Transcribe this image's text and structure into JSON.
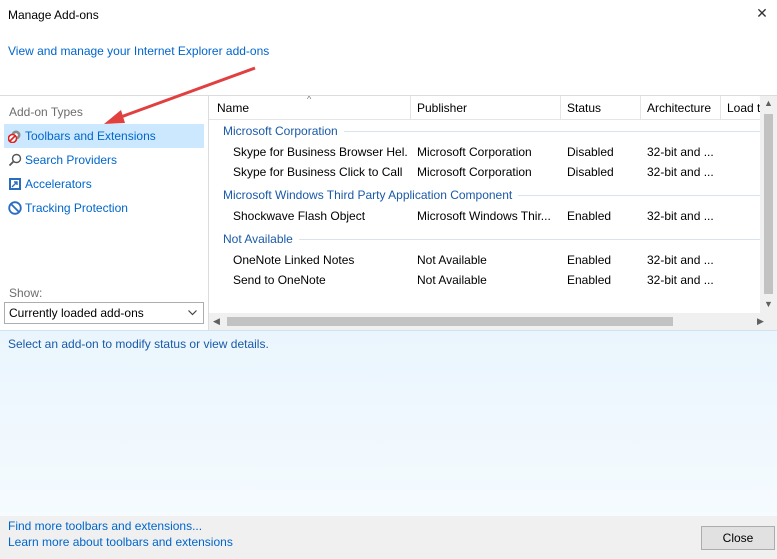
{
  "window": {
    "title": "Manage Add-ons"
  },
  "header": {
    "link": "View and manage your Internet Explorer add-ons"
  },
  "sidebar": {
    "label": "Add-on Types",
    "items": [
      {
        "label": "Toolbars and Extensions",
        "icon": "gear-block-icon",
        "selected": true
      },
      {
        "label": "Search Providers",
        "icon": "search-icon",
        "selected": false
      },
      {
        "label": "Accelerators",
        "icon": "accelerator-icon",
        "selected": false
      },
      {
        "label": "Tracking Protection",
        "icon": "tracking-protection-icon",
        "selected": false
      }
    ],
    "show_label": "Show:",
    "show_value": "Currently loaded add-ons"
  },
  "table": {
    "columns": [
      "Name",
      "Publisher",
      "Status",
      "Architecture",
      "Load tir"
    ],
    "groups": [
      {
        "name": "Microsoft Corporation",
        "rows": [
          [
            "Skype for Business Browser Hel...",
            "Microsoft Corporation",
            "Disabled",
            "32-bit and ..."
          ],
          [
            "Skype for Business Click to Call",
            "Microsoft Corporation",
            "Disabled",
            "32-bit and ..."
          ]
        ]
      },
      {
        "name": "Microsoft Windows Third Party Application Component",
        "rows": [
          [
            "Shockwave Flash Object",
            "Microsoft Windows Thir...",
            "Enabled",
            "32-bit and ..."
          ]
        ]
      },
      {
        "name": "Not Available",
        "rows": [
          [
            "OneNote Linked Notes",
            "Not Available",
            "Enabled",
            "32-bit and ..."
          ],
          [
            "Send to OneNote",
            "Not Available",
            "Enabled",
            "32-bit and ..."
          ]
        ]
      }
    ]
  },
  "details": {
    "text": "Select an add-on to modify status or view details."
  },
  "footer": {
    "link1": "Find more toolbars and extensions...",
    "link2": "Learn more about toolbars and extensions",
    "close_label": "Close"
  },
  "colors": {
    "link": "#0066cc",
    "group": "#1a5aa8",
    "selected": "#cce8ff",
    "annotation_arrow": "#e04040"
  }
}
